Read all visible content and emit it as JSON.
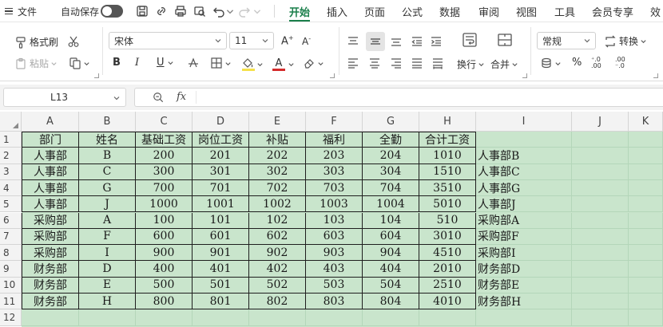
{
  "menubar": {
    "file_label": "文件",
    "autosave_label": "自动保存",
    "tabs": [
      "开始",
      "插入",
      "页面",
      "公式",
      "数据",
      "审阅",
      "视图",
      "工具",
      "会员专享",
      "效"
    ],
    "active_tab": "开始"
  },
  "ribbon": {
    "format_painter": "格式刷",
    "paste": "粘贴",
    "font_name": "宋体",
    "font_size": "11",
    "bold": "B",
    "italic": "I",
    "underline": "U",
    "wrap_text": "换行",
    "merge": "合并",
    "number_format": "常规",
    "convert": "转换"
  },
  "formula_bar": {
    "name_box": "L13",
    "fx_label": "fx",
    "formula": ""
  },
  "sheet": {
    "columns": [
      "A",
      "B",
      "C",
      "D",
      "E",
      "F",
      "G",
      "H",
      "I",
      "J",
      "K"
    ],
    "rows": [
      "1",
      "2",
      "3",
      "4",
      "5",
      "6",
      "7",
      "8",
      "9",
      "10",
      "11",
      "12"
    ],
    "header": [
      "部门",
      "姓名",
      "基础工资",
      "岗位工资",
      "补贴",
      "福利",
      "全勤",
      "合计工资"
    ],
    "data": [
      [
        "人事部",
        "B",
        "200",
        "201",
        "202",
        "203",
        "204",
        "1010",
        "人事部B"
      ],
      [
        "人事部",
        "C",
        "300",
        "301",
        "302",
        "303",
        "304",
        "1510",
        "人事部C"
      ],
      [
        "人事部",
        "G",
        "700",
        "701",
        "702",
        "703",
        "704",
        "3510",
        "人事部G"
      ],
      [
        "人事部",
        "J",
        "1000",
        "1001",
        "1002",
        "1003",
        "1004",
        "5010",
        "人事部J"
      ],
      [
        "采购部",
        "A",
        "100",
        "101",
        "102",
        "103",
        "104",
        "510",
        "采购部A"
      ],
      [
        "采购部",
        "F",
        "600",
        "601",
        "602",
        "603",
        "604",
        "3010",
        "采购部F"
      ],
      [
        "采购部",
        "I",
        "900",
        "901",
        "902",
        "903",
        "904",
        "4510",
        "采购部I"
      ],
      [
        "财务部",
        "D",
        "400",
        "401",
        "402",
        "403",
        "404",
        "2010",
        "财务部D"
      ],
      [
        "财务部",
        "E",
        "500",
        "501",
        "502",
        "503",
        "504",
        "2510",
        "财务部E"
      ],
      [
        "财务部",
        "H",
        "800",
        "801",
        "802",
        "803",
        "804",
        "4010",
        "财务部H"
      ]
    ]
  },
  "colors": {
    "accent": "#1a7f4b",
    "cell_fill": "#c9e5cc",
    "header_fill": "#f3f3f3"
  }
}
